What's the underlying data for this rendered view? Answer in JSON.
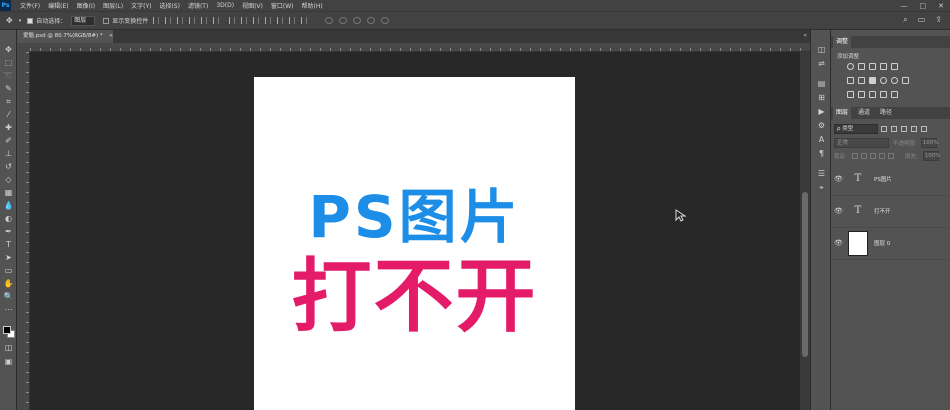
{
  "menubar": {
    "items": [
      "文件(F)",
      "编辑(E)",
      "图像(I)",
      "图层(L)",
      "文字(Y)",
      "选择(S)",
      "滤镜(T)",
      "3D(D)",
      "视图(V)",
      "窗口(W)",
      "帮助(H)"
    ]
  },
  "options": {
    "auto_select_label": "自动选择：",
    "auto_select_value": "图层",
    "show_transform_label": "显示变换控件"
  },
  "document": {
    "tab_title": "爱魁.psd @ 80.7%(RGB/8#) *",
    "line1": "PS图片",
    "line2": "打不开",
    "colors": {
      "line1": "#1d8ee8",
      "line2": "#e31b68",
      "canvas_bg": "#282828",
      "doc_bg": "#ffffff"
    }
  },
  "panels": {
    "adjust_tab": "调整",
    "adjust_title": "添加调整",
    "layers_tab": "图层",
    "channels_tab": "通道",
    "paths_tab": "路径",
    "filter_kind": "ρ 类型",
    "blend_mode": "正常",
    "opacity_label": "不透明度:",
    "opacity_value": "100%",
    "lock_label": "锁定:",
    "fill_label": "填充:",
    "fill_value": "100%",
    "layers": [
      {
        "name": "PS图片",
        "type": "text"
      },
      {
        "name": "打不开",
        "type": "text"
      },
      {
        "name": "图层 0",
        "type": "pixel"
      }
    ]
  }
}
